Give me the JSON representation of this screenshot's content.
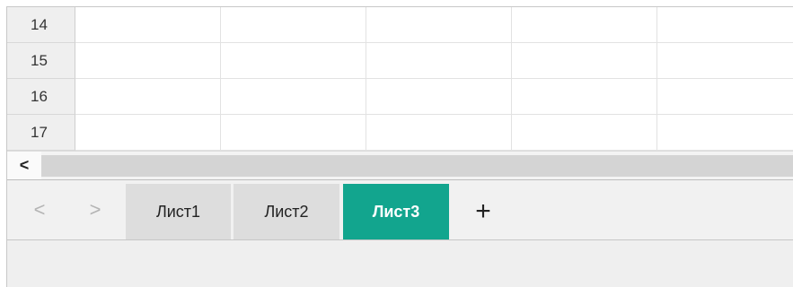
{
  "grid": {
    "rows": [
      {
        "label": "14"
      },
      {
        "label": "15"
      },
      {
        "label": "16"
      },
      {
        "label": "17"
      }
    ]
  },
  "scrollbar": {
    "left_arrow": "<"
  },
  "sheet_nav": {
    "prev": "<",
    "next": ">"
  },
  "sheets": [
    {
      "name": "Лист1",
      "active": false
    },
    {
      "name": "Лист2",
      "active": false
    },
    {
      "name": "Лист3",
      "active": true
    }
  ],
  "add_sheet_label": "+",
  "colors": {
    "active_tab": "#12a58e"
  }
}
